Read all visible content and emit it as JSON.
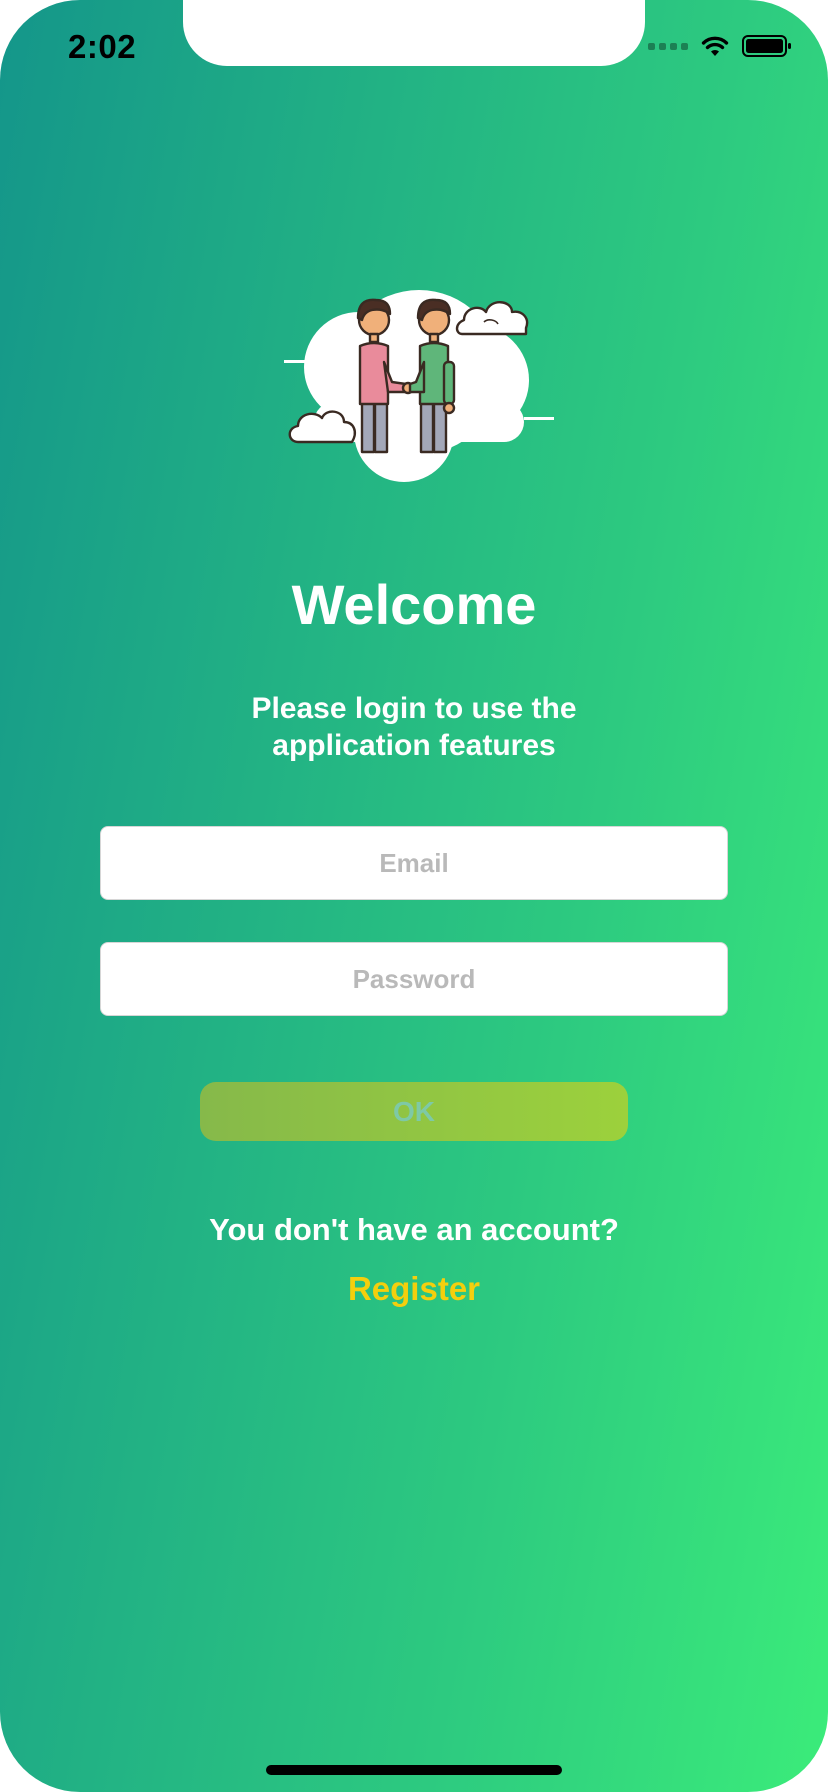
{
  "status_bar": {
    "time": "2:02",
    "icons": [
      "cellular-signal-icon",
      "wifi-icon",
      "battery-icon"
    ]
  },
  "illustration": {
    "name": "handshake-illustration"
  },
  "login": {
    "title": "Welcome",
    "subtitle": "Please login to use the application features",
    "email_placeholder": "Email",
    "email_value": "",
    "password_placeholder": "Password",
    "password_value": "",
    "ok_label": "OK"
  },
  "register": {
    "question": "You don't have an account?",
    "link_label": "Register"
  },
  "colors": {
    "gradient_start": "#14968a",
    "gradient_end": "#3bec7a",
    "ok_button": "#94c943",
    "register_link": "#f4cf0d"
  }
}
